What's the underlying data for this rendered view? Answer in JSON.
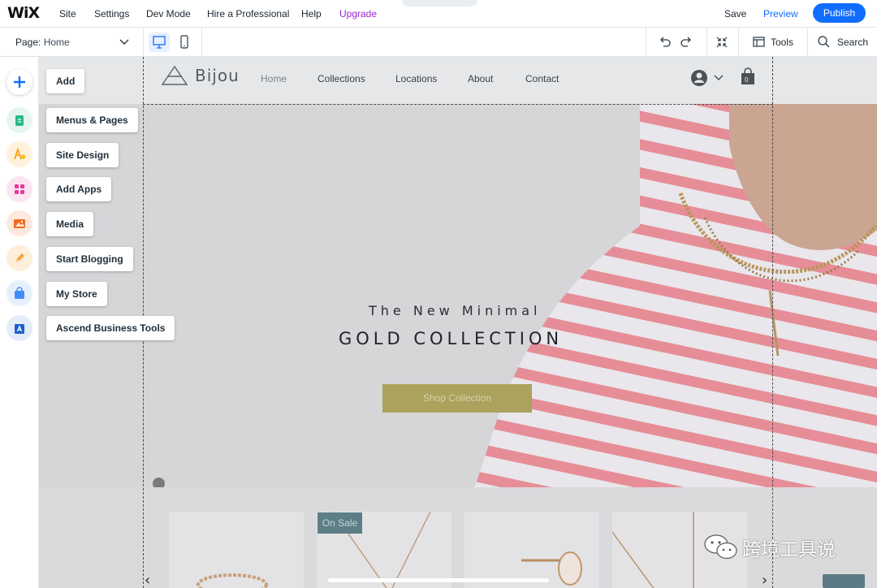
{
  "topbar": {
    "logo": "WiX",
    "menu": [
      "Site",
      "Settings",
      "Dev Mode",
      "Hire a Professional",
      "Help",
      "Upgrade"
    ],
    "save": "Save",
    "preview": "Preview",
    "publish": "Publish"
  },
  "toolbar": {
    "page_label": "Page:",
    "page_name": "Home",
    "tools": "Tools",
    "search": "Search"
  },
  "add_panel": {
    "items": [
      {
        "label": "Add",
        "icon": "plus-icon",
        "color": "#116dff"
      },
      {
        "label": "Menus & Pages",
        "icon": "pages-icon",
        "color": "#25b98a"
      },
      {
        "label": "Site Design",
        "icon": "site-design-icon",
        "color": "#f7a31c"
      },
      {
        "label": "Add Apps",
        "icon": "apps-icon",
        "color": "#e8399c"
      },
      {
        "label": "Media",
        "icon": "media-icon",
        "color": "#f26b21"
      },
      {
        "label": "Start Blogging",
        "icon": "blog-icon",
        "color": "#f4a742"
      },
      {
        "label": "My Store",
        "icon": "store-icon",
        "color": "#3e8ef7"
      },
      {
        "label": "Ascend Business Tools",
        "icon": "ascend-icon",
        "color": "#1d5fcf"
      }
    ]
  },
  "site": {
    "brand": "Bijou",
    "nav": [
      "Home",
      "Collections",
      "Locations",
      "About",
      "Contact"
    ],
    "cart_count": "0",
    "hero": {
      "lead": "The New Minimal",
      "title": "GOLD COLLECTION",
      "cta": "Shop Collection"
    },
    "badge": "On Sale"
  },
  "watermark": "跨境工具说"
}
